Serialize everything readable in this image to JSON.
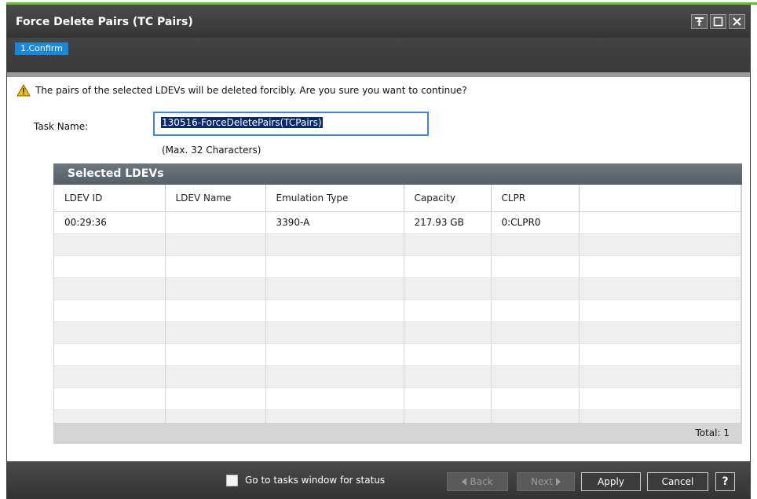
{
  "window": {
    "title": "Force Delete Pairs (TC Pairs)",
    "step_label": "1.Confirm",
    "controls": [
      "pin-icon",
      "maximize-icon",
      "close-icon"
    ]
  },
  "warning": {
    "icon": "warning-icon",
    "text": "The pairs of the selected LDEVs will be deleted forcibly. Are you sure you want to continue?"
  },
  "task": {
    "label": "Task Name:",
    "value": "130516-ForceDeletePairs(TCPairs)",
    "hint": "(Max. 32 Characters)"
  },
  "table": {
    "title": "Selected LDEVs",
    "columns": [
      "LDEV ID",
      "LDEV Name",
      "Emulation Type",
      "Capacity",
      "CLPR",
      ""
    ],
    "rows": [
      [
        "00:29:36",
        "",
        "3390-A",
        "217.93 GB",
        "0:CLPR0",
        ""
      ]
    ],
    "total_label": "Total:",
    "total_value": "1"
  },
  "footer": {
    "checkbox_label": "Go to tasks window for status",
    "checkbox_checked": false,
    "back_label": "Back",
    "next_label": "Next",
    "apply_label": "Apply",
    "cancel_label": "Cancel",
    "help_label": "?"
  },
  "colors": {
    "accent_green": "#5fc02a",
    "step_blue": "#1a88d8",
    "input_focus": "#3a87d6",
    "warning_yellow": "#f2c200"
  }
}
